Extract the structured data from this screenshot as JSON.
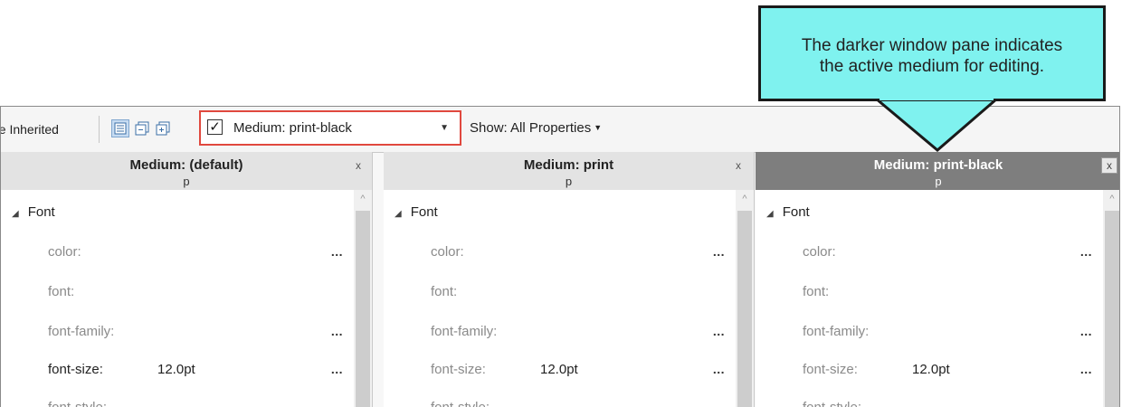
{
  "toolbar": {
    "hide_inherited_label": "de Inherited",
    "medium_checkbox_checked": "✓",
    "medium_select_value": "Medium: print-black",
    "show_label": "Show: All Properties"
  },
  "panes": [
    {
      "title": "Medium: (default)",
      "selector": "p",
      "close_label": "x",
      "group": "Font",
      "properties": [
        {
          "name": "color:",
          "value": "",
          "dots": "..."
        },
        {
          "name": "font:",
          "value": "",
          "dots": ""
        },
        {
          "name": "font-family:",
          "value": "",
          "dots": "..."
        },
        {
          "name": "font-size:",
          "value": "12.0pt",
          "dots": "..."
        },
        {
          "name": "font-style:",
          "value": "",
          "dots": ""
        }
      ]
    },
    {
      "title": "Medium: print",
      "selector": "p",
      "close_label": "x",
      "group": "Font",
      "properties": [
        {
          "name": "color:",
          "value": "",
          "dots": "..."
        },
        {
          "name": "font:",
          "value": "",
          "dots": ""
        },
        {
          "name": "font-family:",
          "value": "",
          "dots": "..."
        },
        {
          "name": "font-size:",
          "value": "12.0pt",
          "dots": "..."
        },
        {
          "name": "font-style:",
          "value": "",
          "dots": ""
        }
      ]
    },
    {
      "title": "Medium: print-black",
      "selector": "p",
      "close_label": "x",
      "group": "Font",
      "properties": [
        {
          "name": "color:",
          "value": "",
          "dots": "..."
        },
        {
          "name": "font:",
          "value": "",
          "dots": ""
        },
        {
          "name": "font-family:",
          "value": "",
          "dots": "..."
        },
        {
          "name": "font-size:",
          "value": "12.0pt",
          "dots": "..."
        },
        {
          "name": "font-style:",
          "value": "",
          "dots": ""
        }
      ]
    }
  ],
  "callout": {
    "text_line1": "The darker window pane indicates",
    "text_line2": "the active medium for editing."
  },
  "colors": {
    "callout_fill": "#7ff2ef",
    "active_pane_header": "#7e7e7e",
    "highlight_border": "#e0483e"
  }
}
